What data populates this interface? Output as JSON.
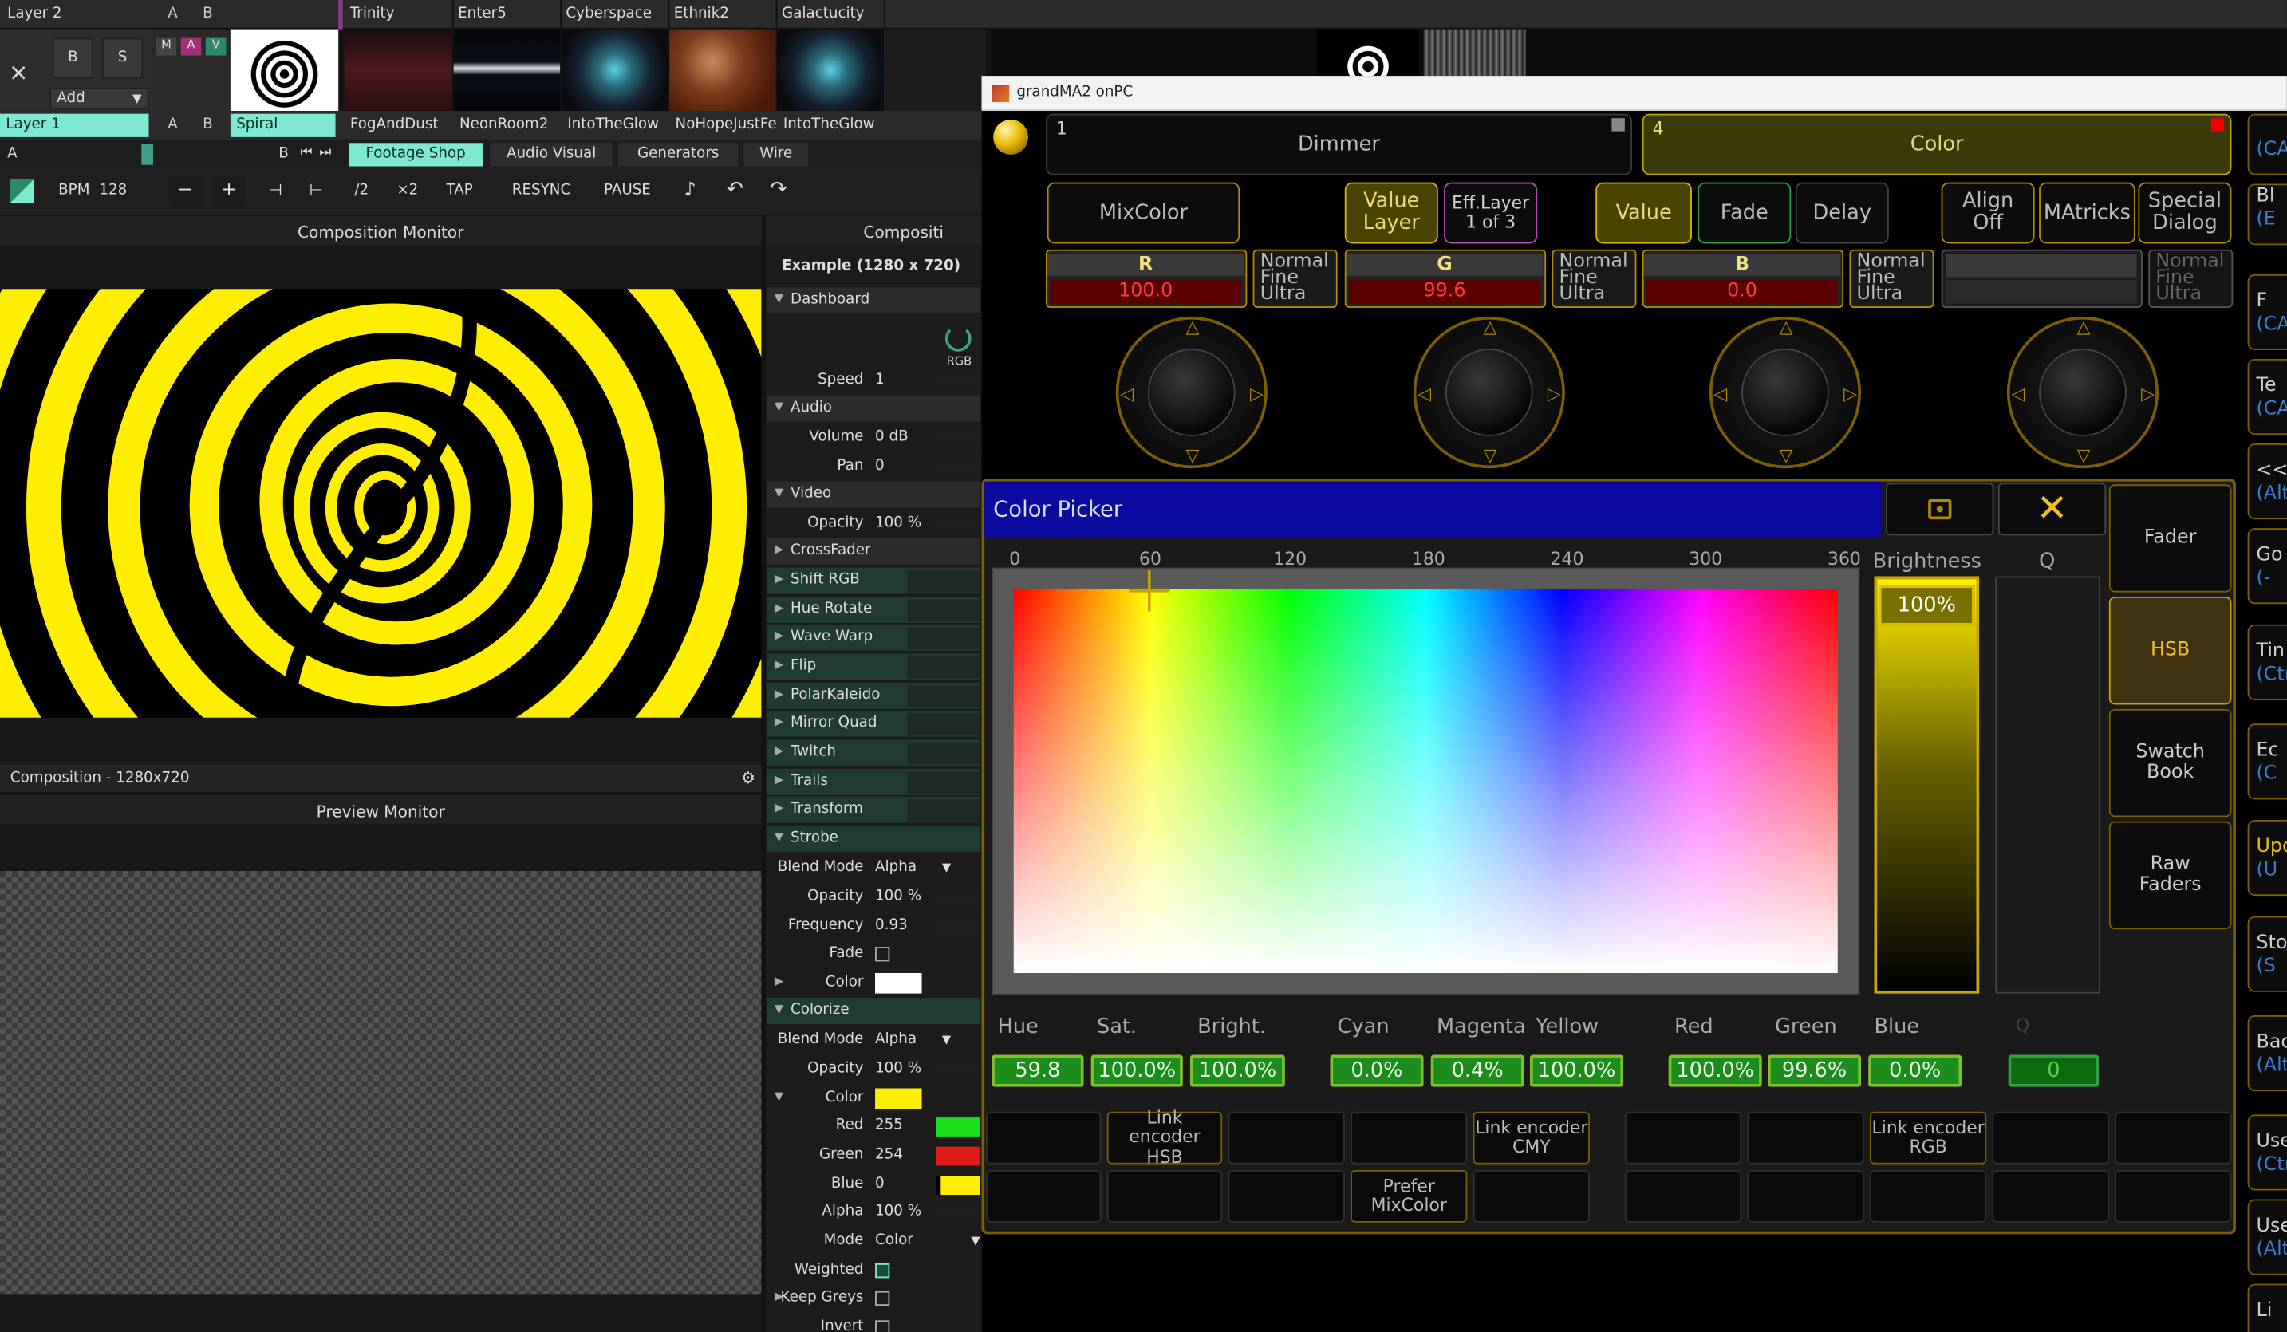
{
  "resolume": {
    "layer2": {
      "name": "Layer 2",
      "a": "A",
      "b": "B",
      "clips": [
        "Trinity",
        "Enter5",
        "Cyberspace",
        "Ethnik2",
        "Galactucity"
      ]
    },
    "layer1": {
      "name": "Layer 1",
      "a": "A",
      "b": "B",
      "clips": [
        "Spiral",
        "FogAndDust",
        "NeonRoom2",
        "IntoTheGlow",
        "NoHopeJustFear",
        "IntoTheGlow"
      ]
    },
    "controls": {
      "close": "×",
      "b": "B",
      "s": "S",
      "add": "Add",
      "m": "M",
      "a": "A",
      "v": "V"
    },
    "column_bar": {
      "a": "A",
      "b": "B",
      "tabs": [
        "Footage Shop",
        "Audio Visual",
        "Generators",
        "Wire"
      ]
    },
    "transport": {
      "bpm_label": "BPM",
      "bpm": "128",
      "minus": "−",
      "plus": "+",
      "half": "/2",
      "double": "×2",
      "tap": "TAP",
      "resync": "RESYNC",
      "pause": "PAUSE"
    },
    "composition_monitor": "Composition Monitor",
    "composition_footer": "Composition - 1280x720",
    "preview_monitor": "Preview Monitor",
    "panel": {
      "title": "Compositi",
      "example": "Example (1280 x 720)",
      "dashboard": "Dashboard",
      "rgb": "RGB",
      "speed_label": "Speed",
      "speed": "1",
      "audio": "Audio",
      "volume_label": "Volume",
      "volume": "0 dB",
      "pan_label": "Pan",
      "pan": "0",
      "video": "Video",
      "opacity_label": "Opacity",
      "opacity": "100 %",
      "effects": [
        "CrossFader",
        "Shift RGB",
        "Hue Rotate",
        "Wave Warp",
        "Flip",
        "PolarKaleido",
        "Mirror Quad",
        "Twitch",
        "Trails",
        "Transform"
      ],
      "strobe": {
        "name": "Strobe",
        "blend_label": "Blend Mode",
        "blend": "Alpha",
        "opacity_label": "Opacity",
        "opacity": "100 %",
        "freq_label": "Frequency",
        "freq": "0.93",
        "fade_label": "Fade",
        "color_label": "Color"
      },
      "colorize": {
        "name": "Colorize",
        "blend_label": "Blend Mode",
        "blend": "Alpha",
        "opacity_label": "Opacity",
        "opacity": "100 %",
        "color_label": "Color",
        "red_label": "Red",
        "red": "255",
        "green_label": "Green",
        "green": "254",
        "blue_label": "Blue",
        "blue": "0",
        "alpha_label": "Alpha",
        "alpha": "100 %",
        "mode_label": "Mode",
        "mode": "Color",
        "weighted_label": "Weighted",
        "keepgreys_label": "Keep Greys",
        "invert_label": "Invert"
      }
    }
  },
  "gma": {
    "window_title": "grandMA2 onPC",
    "features": [
      {
        "num": "1",
        "name": "Dimmer"
      },
      {
        "num": "4",
        "name": "Color"
      }
    ],
    "buttons": {
      "mixcolor": "MixColor",
      "value_layer": "Value Layer",
      "eff_layer": "Eff.Layer",
      "eff_layer_sub": "1 of 3",
      "value": "Value",
      "fade": "Fade",
      "delay": "Delay",
      "align": "Align Off",
      "matricks": "MAtricks",
      "special": "Special Dialog"
    },
    "encoders": [
      {
        "name": "R",
        "value": "100.0",
        "res": "Normal Fine Ultra"
      },
      {
        "name": "G",
        "value": "99.6",
        "res": "Normal Fine Ultra"
      },
      {
        "name": "B",
        "value": "0.0",
        "res": "Normal Fine Ultra"
      },
      {
        "name": "",
        "value": "",
        "res": "Normal Fine Ultra"
      }
    ],
    "picker": {
      "title": "Color Picker",
      "hue_ticks": [
        "0",
        "60",
        "120",
        "180",
        "240",
        "300",
        "360"
      ],
      "brightness_label": "Brightness",
      "brightness": "100%",
      "q_label": "Q"
    },
    "side_buttons": [
      "Fader",
      "HSB",
      "Swatch Book",
      "Raw Faders"
    ],
    "value_labels": [
      "Hue",
      "Sat.",
      "Bright.",
      "Cyan",
      "Magenta",
      "Yellow",
      "Red",
      "Green",
      "Blue",
      "Q"
    ],
    "values": [
      "59.8",
      "100.0%",
      "100.0%",
      "0.0%",
      "0.4%",
      "100.0%",
      "100.0%",
      "99.6%",
      "0.0%",
      "0"
    ],
    "links": {
      "hsb": "Link encoder HSB",
      "cmy": "Link encoder CMY",
      "rgb": "Link encoder RGB",
      "prefer": "Prefer MixColor"
    },
    "right_sidebar": [
      {
        "a": "",
        "b": "(CA"
      },
      {
        "a": "Bl",
        "b": "(E"
      },
      {
        "a": "F",
        "b": "(CA"
      },
      {
        "a": "Te",
        "b": "(CA"
      },
      {
        "a": "<<",
        "b": "(Alt"
      },
      {
        "a": "Go",
        "b": "(-"
      },
      {
        "a": "Tin",
        "b": "(Ctr"
      },
      {
        "a": "Ec",
        "b": "(C"
      },
      {
        "a": "Upd",
        "b": "(U"
      },
      {
        "a": "Sto",
        "b": "(S"
      },
      {
        "a": "Bac",
        "b": "(Alt"
      },
      {
        "a": "Use",
        "b": "(Ctr"
      },
      {
        "a": "Use",
        "b": "(Alt"
      },
      {
        "a": "Li",
        "b": ""
      }
    ]
  }
}
